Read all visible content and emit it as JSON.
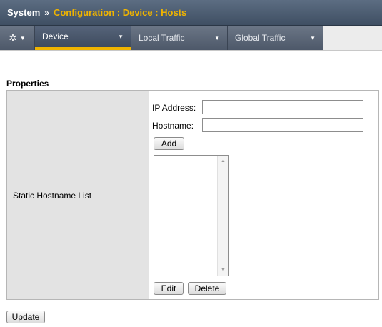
{
  "header": {
    "system": "System",
    "separator": "»",
    "breadcrumb": "Configuration : Device : Hosts"
  },
  "tabs": [
    {
      "label": "Device",
      "active": true
    },
    {
      "label": "Local Traffic",
      "active": false
    },
    {
      "label": "Global Traffic",
      "active": false
    }
  ],
  "section_title": "Properties",
  "properties": {
    "row_label": "Static Hostname List",
    "ip_label": "IP Address:",
    "ip_value": "",
    "hostname_label": "Hostname:",
    "hostname_value": "",
    "add_label": "Add",
    "edit_label": "Edit",
    "delete_label": "Delete",
    "list_items": []
  },
  "update_label": "Update",
  "colors": {
    "accent": "#f0b400",
    "titlebar": "#4b5b70"
  }
}
